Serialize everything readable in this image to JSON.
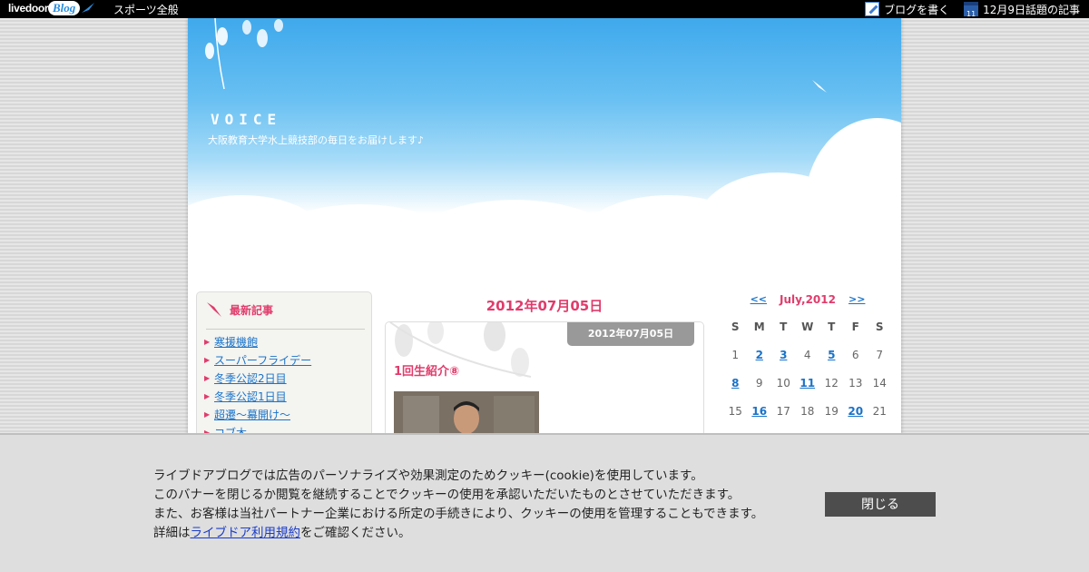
{
  "topbar": {
    "logo_text": "livedoor",
    "logo_blog": "Blog",
    "nav_sports": "スポーツ全般",
    "write_blog": "ブログを書く",
    "calendar_icon_day": "11",
    "trending": "12月9日話題の記事"
  },
  "header": {
    "title": "VOICE",
    "description": "大阪教育大学水上競技部の毎日をお届けします♪"
  },
  "sidebar": {
    "heading": "最新記事",
    "items": [
      {
        "label": "寒援機飽"
      },
      {
        "label": "スーパーフライデー"
      },
      {
        "label": "冬季公認2日目"
      },
      {
        "label": "冬季公認1日目"
      },
      {
        "label": "超遷～幕開け～"
      },
      {
        "label": "コブ木"
      }
    ]
  },
  "main": {
    "date_heading": "2012年07月05日",
    "entry": {
      "date_tab": "2012年07月05日",
      "title": "1回生紹介⑧"
    }
  },
  "calendar": {
    "prev": "<<",
    "month": "July,2012",
    "next": ">>",
    "weekdays": [
      "S",
      "M",
      "T",
      "W",
      "T",
      "F",
      "S"
    ],
    "days": [
      {
        "d": "1",
        "link": false
      },
      {
        "d": "2",
        "link": true
      },
      {
        "d": "3",
        "link": true
      },
      {
        "d": "4",
        "link": false
      },
      {
        "d": "5",
        "link": true
      },
      {
        "d": "6",
        "link": false
      },
      {
        "d": "7",
        "link": false
      },
      {
        "d": "8",
        "link": true
      },
      {
        "d": "9",
        "link": false
      },
      {
        "d": "10",
        "link": false
      },
      {
        "d": "11",
        "link": true
      },
      {
        "d": "12",
        "link": false
      },
      {
        "d": "13",
        "link": false
      },
      {
        "d": "14",
        "link": false
      },
      {
        "d": "15",
        "link": false
      },
      {
        "d": "16",
        "link": true
      },
      {
        "d": "17",
        "link": false
      },
      {
        "d": "18",
        "link": false
      },
      {
        "d": "19",
        "link": false
      },
      {
        "d": "20",
        "link": true
      },
      {
        "d": "21",
        "link": false
      }
    ]
  },
  "cookie": {
    "line1": "ライブドアブログでは広告のパーソナライズや効果測定のためクッキー(cookie)を使用しています。",
    "line2": "このバナーを閉じるか閲覧を継続することでクッキーの使用を承認いただいたものとさせていただきます。",
    "line3": "また、お客様は当社パートナー企業における所定の手続きにより、クッキーの使用を管理することもできます。",
    "line4_prefix": "詳細は",
    "line4_link": "ライブドア利用規約",
    "line4_suffix": "をご確認ください。",
    "close_label": "閉じる"
  },
  "colors": {
    "accent_pink": "#e03c6c",
    "link_blue": "#1a73c9",
    "sky_blue": "#3fa9ec"
  }
}
